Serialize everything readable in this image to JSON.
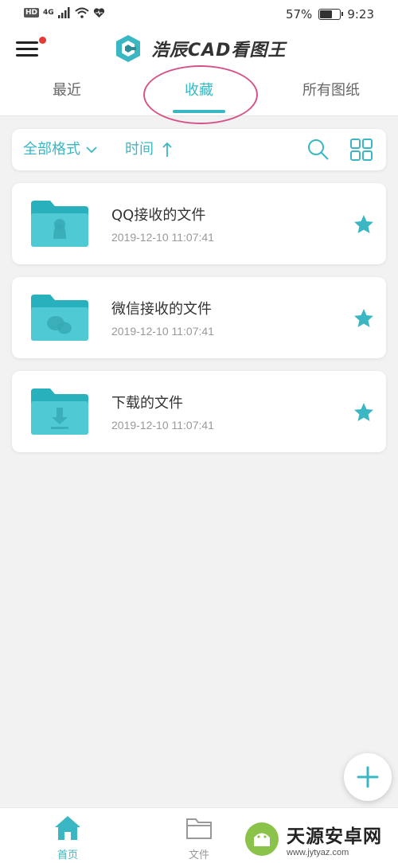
{
  "status_bar": {
    "left_indicator": "HD",
    "network": "4G",
    "battery_percent": "57%",
    "battery_level": 0.57,
    "time": "9:23"
  },
  "app_bar": {
    "title": "浩辰CAD看图王",
    "has_notification_dot": true
  },
  "tabs": [
    {
      "label": "最近",
      "active": false
    },
    {
      "label": "收藏",
      "active": true
    },
    {
      "label": "所有图纸",
      "active": false
    }
  ],
  "filter": {
    "format_label": "全部格式",
    "sort_label": "时间"
  },
  "files": [
    {
      "name": "QQ接收的文件",
      "date": "2019-12-10 11:07:41",
      "folder_icon": "qq-icon",
      "starred": true
    },
    {
      "name": "微信接收的文件",
      "date": "2019-12-10 11:07:41",
      "folder_icon": "wechat-icon",
      "starred": true
    },
    {
      "name": "下载的文件",
      "date": "2019-12-10 11:07:41",
      "folder_icon": "download-icon",
      "starred": true
    }
  ],
  "bottom_nav": [
    {
      "label": "首页",
      "icon": "home-icon",
      "active": true
    },
    {
      "label": "文件",
      "icon": "folder-icon",
      "active": false
    }
  ],
  "watermark": {
    "title": "天源安卓网",
    "url": "www.jytyaz.com"
  },
  "colors": {
    "accent": "#3bb7c3",
    "annotation": "#d6538a",
    "notification": "#e53935"
  }
}
